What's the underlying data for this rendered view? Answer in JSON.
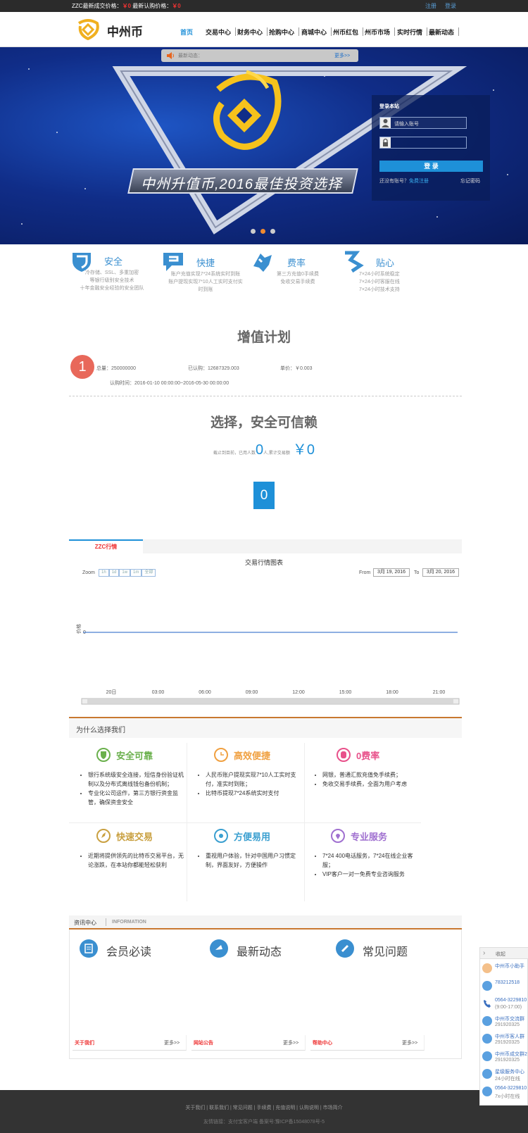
{
  "topbar": {
    "deal_label": "ZZC最新成交价格：",
    "deal_value": "￥0",
    "sub_label": "最新认购价格：",
    "sub_value": "￥0",
    "register": "注册",
    "login": "登录"
  },
  "header": {
    "logo_text": "中州币",
    "nav": [
      "首页",
      "交易中心",
      "财务中心",
      "抢购中心",
      "商城中心",
      "州币红包",
      "州币市场",
      "实时行情",
      "最新动态"
    ]
  },
  "notice": {
    "text": "最新动态：",
    "more": "更多>>"
  },
  "banner": {
    "slogan": "中州升值币,2016最佳投资选择"
  },
  "login_box": {
    "title": "登录本站",
    "account_placeholder": "请输入账号",
    "password_placeholder": "",
    "login_button": "登 录",
    "no_account": "还没有账号？",
    "register_link": "免费注册",
    "forgot": "忘记密码"
  },
  "features": [
    {
      "title": "安全",
      "lines": [
        "冷存储、SSL、多重加密",
        "等银行级别安全技术",
        "十年金融安全经验的安全团队"
      ]
    },
    {
      "title": "快捷",
      "lines": [
        "账户充值实现7*24系统实时到账",
        "账户提现实现7*10人工实时支付实",
        "时到账"
      ]
    },
    {
      "title": "费率",
      "lines": [
        "第三方充值0手续费",
        "免收交易手续费"
      ]
    },
    {
      "title": "贴心",
      "lines": [
        "7×24小时系统稳定",
        "7×24小时客服在线",
        "7×24小时技术支持"
      ]
    }
  ],
  "plan": {
    "title": "增值计划",
    "badge": "1",
    "total": "总量：250000000",
    "subscribed": "已认购：12687329.003",
    "price": "单价：￥0.003",
    "period": "认购时间：2016-01-10 00:00:00~2016-05-30 00:00:00"
  },
  "trust": {
    "title": "选择，安全可信赖",
    "stat_prefix": "截止到目前，已用人数",
    "stat_people": "0",
    "stat_mid": "人,累计交易额",
    "stat_amount": "￥0",
    "counter": "0"
  },
  "chart_panel": {
    "tab": "ZZC行情",
    "title": "交易行情图表",
    "zoom_label": "Zoom",
    "zoom": [
      "1h",
      "1d",
      "1w",
      "1m",
      "全部"
    ],
    "from_label": "From",
    "from_date": "3月 19, 2016",
    "to_label": "To",
    "to_date": "3月 20, 2016"
  },
  "chart_data": {
    "type": "line",
    "title": "交易行情图表",
    "ylabel": "价格",
    "x": [
      "20日",
      "03:00",
      "06:00",
      "09:00",
      "12:00",
      "15:00",
      "18:00",
      "21:00"
    ],
    "series": [
      {
        "values": [
          0,
          0,
          0,
          0,
          0,
          0,
          0,
          0
        ]
      }
    ],
    "yticks": [
      "0"
    ]
  },
  "why": {
    "title": "为什么选择我们",
    "items": [
      {
        "title": "安全可靠",
        "color": "#6ab04c",
        "points": [
          "银行系统级安全连接，短信身份验证机制以及分布式离线钱包备份机制；",
          "专业化公司运作，第三方银行资金监管，确保资金安全"
        ]
      },
      {
        "title": "高效便捷",
        "color": "#f0a040",
        "points": [
          "人民币账户提现实现7*10人工实时支付，准实时到账；",
          "比特币提现7*24系统实时支付"
        ]
      },
      {
        "title": "0费率",
        "color": "#e8508a",
        "points": [
          "网银，普通汇款充值免手续费；",
          "免收交易手续费，全面为用户考虑"
        ]
      },
      {
        "title": "快速交易",
        "color": "#c9a040",
        "points": [
          "近期将提供领先的比特币交易平台，无论涨跌，在本站你都能轻松获利"
        ]
      },
      {
        "title": "方便易用",
        "color": "#3a9fd0",
        "points": [
          "重视用户体验，针对中国用户习惯定制，界面友好，方便操作"
        ]
      },
      {
        "title": "专业服务",
        "color": "#a070d0",
        "points": [
          "7*24 400电话服务，7*24在线企业客服；",
          "VIP客户一对一免费专业咨询服务"
        ]
      }
    ]
  },
  "info": {
    "tab": "资讯中心",
    "tab_en": "INFORMATION",
    "cols": [
      "会员必读",
      "最新动态",
      "常见问题"
    ],
    "lists": [
      {
        "title": "关于我们",
        "more": "更多>>"
      },
      {
        "title": "网站公告",
        "more": "更多>>"
      },
      {
        "title": "帮助中心",
        "more": "更多>>"
      }
    ]
  },
  "footer": {
    "links": [
      "关于我们",
      "联系我们",
      "常见问题",
      "手续费",
      "充值说明",
      "认购说明",
      "市场简介"
    ],
    "copyright": "友情链接：支付宝客户端 备案号:豫ICP备15048078号-5"
  },
  "side": {
    "collapse": "收起",
    "items": [
      {
        "name": "中州币小助手",
        "sub": ""
      },
      {
        "name": "783212518",
        "sub": ""
      },
      {
        "name": "0564-3229810",
        "sub": "(9:00-17:00)"
      },
      {
        "name": "中州币交流群",
        "sub": "291920325"
      },
      {
        "name": "中州币客人群",
        "sub": "291920325"
      },
      {
        "name": "中州币成交群2",
        "sub": "291920325"
      },
      {
        "name": "星级服务中心",
        "sub": "24小时在线"
      },
      {
        "name": "0564-3229810",
        "sub": "7x小时在线"
      }
    ]
  },
  "colors": {
    "accent": "#1e90d8",
    "orange": "#e86a2a",
    "red": "#e33"
  }
}
